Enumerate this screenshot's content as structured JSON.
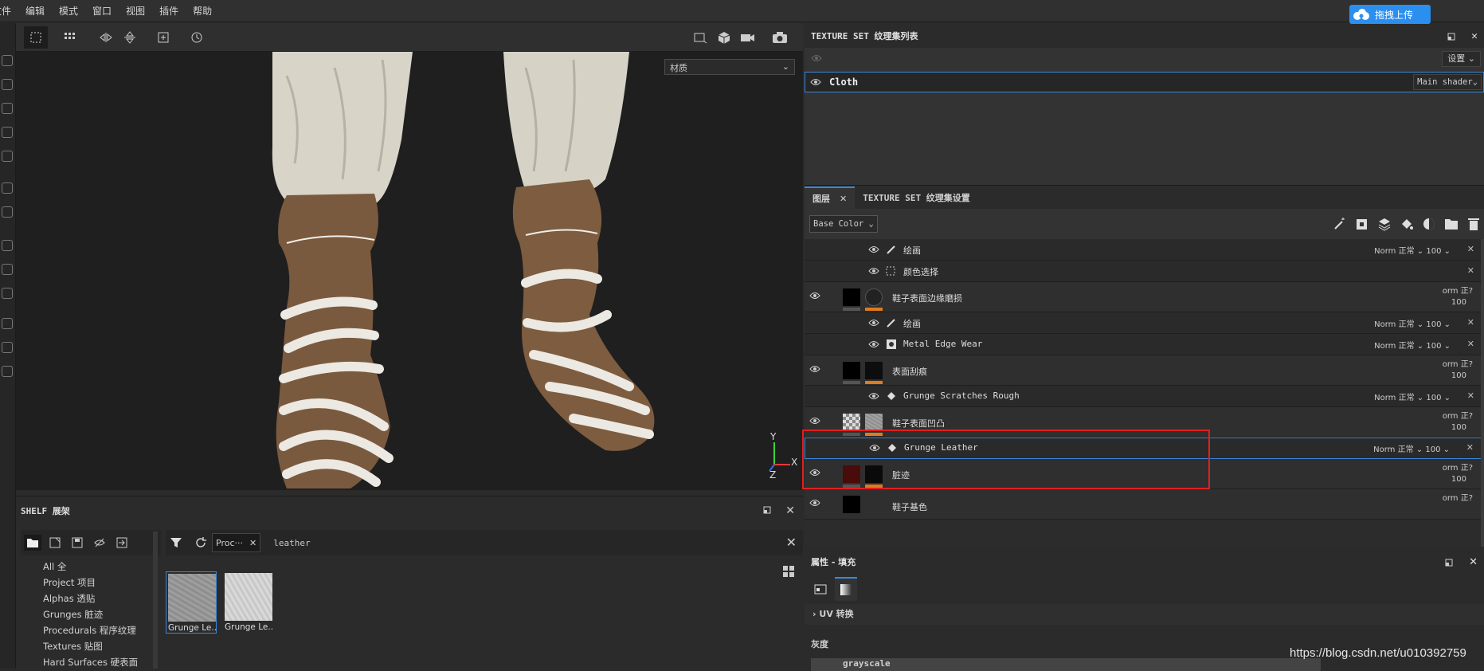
{
  "menu": [
    "文件",
    "编辑",
    "模式",
    "窗口",
    "视图",
    "插件",
    "帮助"
  ],
  "upload_button": "拖拽上传",
  "viewport": {
    "material_select": "材质",
    "axis_y": "Y",
    "axis_x": "X",
    "axis_z": "Z"
  },
  "shelf": {
    "title": "SHELF 展架",
    "categories": [
      "All 全",
      "Project 项目",
      "Alphas 透贴",
      "Grunges 脏迹",
      "Procedurals 程序纹理",
      "Textures 贴图",
      "Hard Surfaces 硬表面"
    ],
    "filter_tag": "Proc···",
    "search_value": "leather",
    "results": [
      "Grunge Le...",
      "Grunge Le..."
    ]
  },
  "texture_set_list": {
    "title": "TEXTURE SET 纹理集列表",
    "settings_label": "设置",
    "set_name": "Cloth",
    "shader": "Main shader"
  },
  "layers_panel": {
    "tab_layers": "图层",
    "tab_settings": "TEXTURE SET 纹理集设置",
    "channel": "Base Color",
    "rows": [
      {
        "name": "绘画",
        "blend": "Norm 正常",
        "opacity": "100"
      },
      {
        "name": "颜色选择",
        "blend": "",
        "opacity": ""
      },
      {
        "name": "鞋子表面边缘磨损",
        "blend": "orm 正?",
        "opacity": "100"
      },
      {
        "name": "绘画",
        "blend": "Norm 正常",
        "opacity": "100"
      },
      {
        "name": "Metal Edge Wear",
        "blend": "Norm 正常",
        "opacity": "100"
      },
      {
        "name": "表面刮痕",
        "blend": "orm 正?",
        "opacity": "100"
      },
      {
        "name": "Grunge Scratches Rough",
        "blend": "Norm 正常",
        "opacity": "100"
      },
      {
        "name": "鞋子表面凹凸",
        "blend": "orm 正?",
        "opacity": "100"
      },
      {
        "name": "Grunge Leather",
        "blend": "Norm 正常",
        "opacity": "100"
      },
      {
        "name": "脏迹",
        "blend": "orm 正?",
        "opacity": "100"
      },
      {
        "name": "鞋子基色",
        "blend": "orm 正?",
        "opacity": ""
      }
    ]
  },
  "properties": {
    "title": "属性 - 填充",
    "uv_section": "UV 转换",
    "gray_label": "灰度",
    "gray_value": "grayscale"
  },
  "watermark": "https://blog.csdn.net/u010392759",
  "colors": {
    "accent": "#3a87d9",
    "highlight_box": "#e02020",
    "mask_orange": "#e07a1f",
    "baidu_blue": "#2b8ff0"
  }
}
